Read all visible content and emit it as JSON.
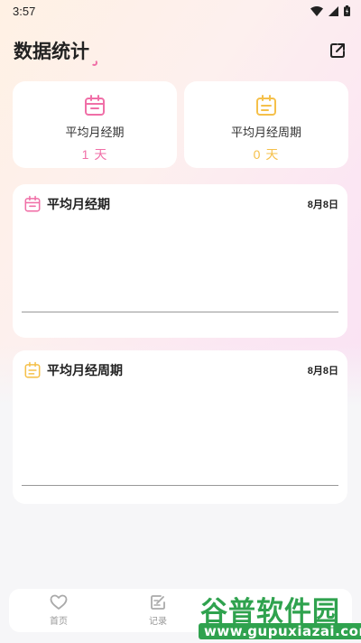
{
  "status_bar": {
    "time": "3:57"
  },
  "header": {
    "title": "数据统计"
  },
  "stats": [
    {
      "label": "平均月经期",
      "value": "1 天",
      "color": "#f06fa7",
      "icon": "calendar-icon"
    },
    {
      "label": "平均月经周期",
      "value": "0 天",
      "color": "#f5c04a",
      "icon": "calendar-list-icon"
    }
  ],
  "charts": [
    {
      "title": "平均月经期",
      "date": "8月8日",
      "color": "#f06fa7",
      "icon": "calendar-icon"
    },
    {
      "title": "平均月经周期",
      "date": "8月8日",
      "color": "#f5c04a",
      "icon": "calendar-list-icon"
    }
  ],
  "nav": {
    "items": [
      {
        "label": "首页",
        "icon": "heart-icon"
      },
      {
        "label": "记录",
        "icon": "edit-note-icon"
      }
    ]
  },
  "watermark": {
    "main": "谷普软件园",
    "sub": "www.gupuxiazai.com"
  },
  "colors": {
    "pink": "#f06fa7",
    "yellow": "#f5c04a",
    "watermark_green": "#2fa24e"
  }
}
